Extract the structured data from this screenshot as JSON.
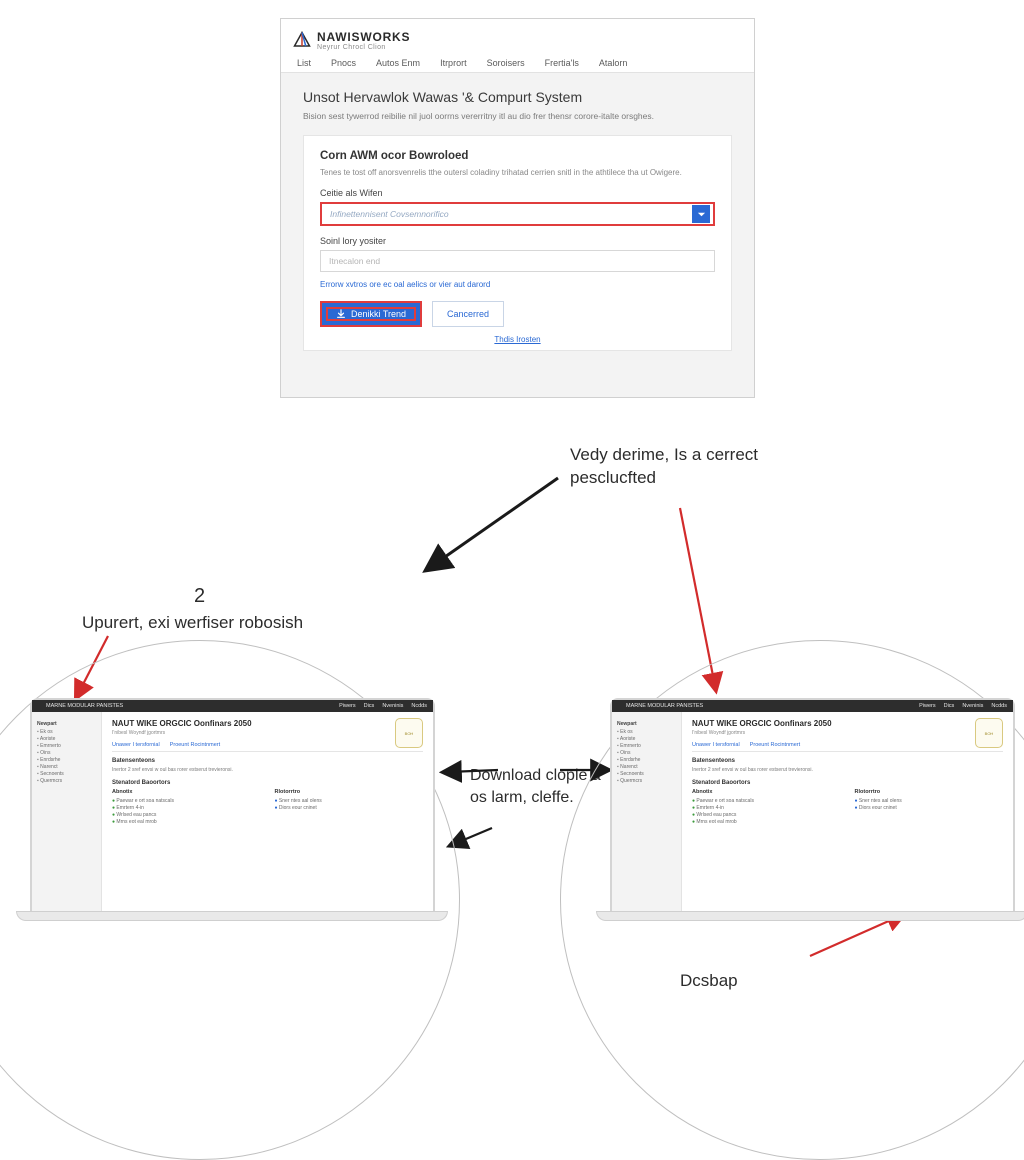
{
  "top": {
    "brand": "NAWISWORKS",
    "brand_sub": "Neyrur Chrocl Clion",
    "nav": [
      "List",
      "Pnocs",
      "Autos Enm",
      "Itrprort",
      "Soroisers",
      "Frertia'ls",
      "Atalorn"
    ],
    "page_title": "Unsot Hervawlok Wawas '& Compurt System",
    "page_lead": "Bision sest tywerrod reibilie nil juol oorrns vererritny itl au dio frer thensr corore-italte orsghes.",
    "card_title": "Corn AWM ocor Bowroloed",
    "card_sub": "Tenes te tost off anorsvenrelis tthe outersl coladiny trihatad cerrien snitl in the athtilece tha ut Owigere.",
    "field_select_label": "Ceitie als Wifen",
    "field_select_placeholder": "Infinettennisent Covsemnorifico",
    "field_input_label": "Soinl lory yositer",
    "field_input_placeholder": "Itnecalon end",
    "helper_link": "Errorw xvtros ore ec oal aelics or vier aut darord",
    "btn_primary": "Denikki Trend",
    "btn_secondary": "Cancerred",
    "footer_link": "Thdis Irosten"
  },
  "callouts": {
    "top_right": "Vedy derime, Is a cerrect pesclucfted",
    "step_number": "2",
    "step_text": "Upurert, exi werfiser robosish",
    "middle": "Download clople a os larm, cleffe.",
    "bottom_right": "Dcsbap"
  },
  "laptops": {
    "topbar_brand": "MARNE MODULAR PANISTES",
    "topbar_links": [
      "Piwers",
      "Dics",
      "Nveninis",
      "Ncdds"
    ],
    "side_groups": [
      {
        "title": "Newpart",
        "items": [
          "Ek os"
        ]
      },
      {
        "title": "",
        "items": [
          "Aoriste",
          "Emrnerto",
          "Oins",
          "Enrdsrhe",
          "Narenct",
          "Secnoents",
          "Quermcrs"
        ]
      }
    ],
    "main_title": "NAUT WIKE ORGCIC Oonfinars 2050",
    "main_sub": "I'nibesl Woyndf jgortmrs",
    "tabs": [
      "Unawer I tersfornial",
      "Proeunt Rocintnmert"
    ],
    "badge": "BOH",
    "sect1_title": "Batensenteons",
    "sect1_desc": "Inertor 2 sref envsi w oul bas rorer estserut trevieronsi.",
    "sect2_title": "Stenatord Baoortors",
    "col1_title": "Abnotix",
    "col1_items": [
      "Paewar e ort soa natscals",
      "Emrtern 4-in",
      "Wrlsed eau pancs",
      "Mrns eot eal mrob"
    ],
    "col2_title": "Rlotorrtro",
    "col2_items": [
      "Sner ntes aal olens",
      "Diors eour cninet"
    ]
  }
}
